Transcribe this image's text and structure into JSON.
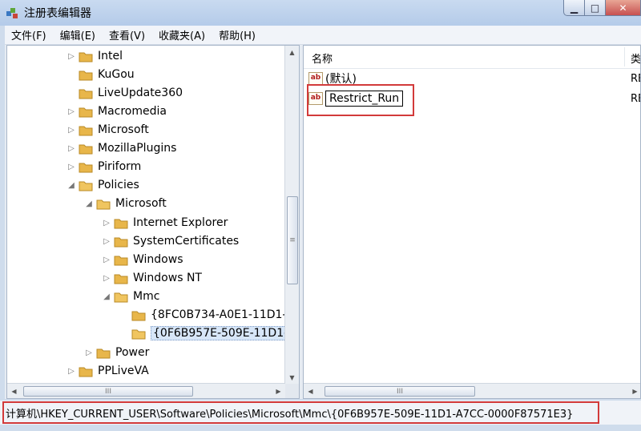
{
  "window": {
    "title": "注册表编辑器",
    "min_glyph": "▁",
    "max_glyph": "□",
    "close_glyph": "✕"
  },
  "menu": [
    {
      "label": "文件(F)"
    },
    {
      "label": "编辑(E)"
    },
    {
      "label": "查看(V)"
    },
    {
      "label": "收藏夹(A)"
    },
    {
      "label": "帮助(H)"
    }
  ],
  "tree": {
    "items": [
      {
        "label": "Intel",
        "expander": "▷"
      },
      {
        "label": "KuGou",
        "expander": ""
      },
      {
        "label": "LiveUpdate360",
        "expander": ""
      },
      {
        "label": "Macromedia",
        "expander": "▷"
      },
      {
        "label": "Microsoft",
        "expander": "▷"
      },
      {
        "label": "MozillaPlugins",
        "expander": "▷"
      },
      {
        "label": "Piriform",
        "expander": "▷"
      },
      {
        "label": "Policies",
        "expander": "◢"
      },
      {
        "label": "Microsoft",
        "expander": "◢"
      },
      {
        "label": "Internet Explorer",
        "expander": "▷"
      },
      {
        "label": "SystemCertificates",
        "expander": "▷"
      },
      {
        "label": "Windows",
        "expander": "▷"
      },
      {
        "label": "Windows NT",
        "expander": "▷"
      },
      {
        "label": "Mmc",
        "expander": "◢"
      },
      {
        "label": "{8FC0B734-A0E1-11D1-",
        "expander": ""
      },
      {
        "label": "{0F6B957E-509E-11D1-A",
        "expander": ""
      },
      {
        "label": "Power",
        "expander": "▷"
      },
      {
        "label": "PPLiveVA",
        "expander": "▷"
      }
    ],
    "vscroll_grip": "≡",
    "hscroll_grip": "III"
  },
  "values": {
    "col_name": "名称",
    "col_type": "类",
    "rows": [
      {
        "name": "(默认)",
        "type": "RE"
      },
      {
        "name": "Restrict_Run",
        "type": "RE"
      }
    ],
    "icon_text": "ab",
    "hscroll_grip": "III"
  },
  "status": {
    "path": "计算机\\HKEY_CURRENT_USER\\Software\\Policies\\Microsoft\\Mmc\\{0F6B957E-509E-11D1-A7CC-0000F87571E3}"
  },
  "colors": {
    "highlight": "#d23a3a",
    "folder": "#e8b64a",
    "selection": "#d7e6f8"
  }
}
